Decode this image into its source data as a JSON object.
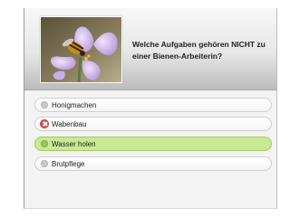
{
  "question": {
    "text": "Welche Aufgaben gehören NICHT zu einer Bienen-Arbeiterin?",
    "image_icon": "crocus-with-bee-image"
  },
  "answers": [
    {
      "label": "Honigmachen",
      "state": "unselected"
    },
    {
      "label": "Wabenbau",
      "state": "incorrect"
    },
    {
      "label": "Wasser holen",
      "state": "correct"
    },
    {
      "label": "Brutpflege",
      "state": "unselected"
    }
  ],
  "colors": {
    "correct_fill": "#c8ea94",
    "incorrect_mark": "#d9534f",
    "header_gradient_bottom": "#bcbcbc"
  }
}
